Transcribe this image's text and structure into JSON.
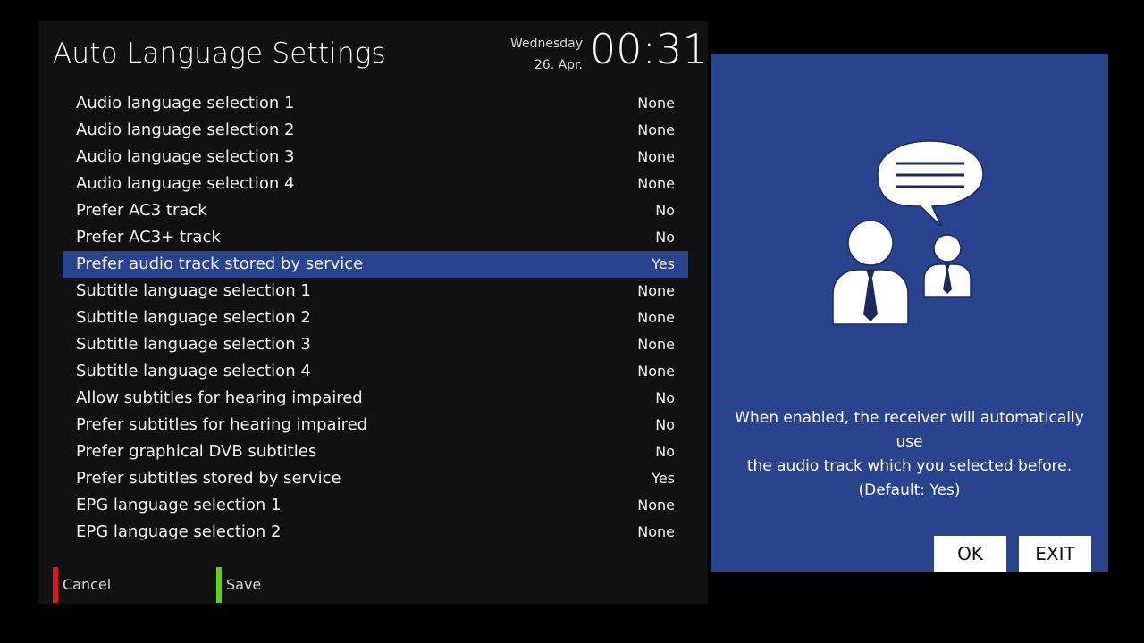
{
  "header": {
    "title": "Auto Language Settings",
    "weekday": "Wednesday",
    "date": "26. Apr.",
    "time": "00:31"
  },
  "settings": [
    {
      "label": "Audio language selection 1",
      "value": "None"
    },
    {
      "label": "Audio language selection 2",
      "value": "None"
    },
    {
      "label": "Audio language selection 3",
      "value": "None"
    },
    {
      "label": "Audio language selection 4",
      "value": "None"
    },
    {
      "label": "Prefer AC3 track",
      "value": "No"
    },
    {
      "label": "Prefer AC3+ track",
      "value": "No"
    },
    {
      "label": "Prefer audio track stored by service",
      "value": "Yes",
      "selected": true
    },
    {
      "label": "Subtitle language selection 1",
      "value": "None"
    },
    {
      "label": "Subtitle language selection 2",
      "value": "None"
    },
    {
      "label": "Subtitle language selection 3",
      "value": "None"
    },
    {
      "label": "Subtitle language selection 4",
      "value": "None"
    },
    {
      "label": "Allow subtitles for hearing impaired",
      "value": "No"
    },
    {
      "label": "Prefer subtitles for hearing impaired",
      "value": "No"
    },
    {
      "label": "Prefer graphical DVB subtitles",
      "value": "No"
    },
    {
      "label": "Prefer subtitles stored by service",
      "value": "Yes"
    },
    {
      "label": "EPG language selection 1",
      "value": "None"
    },
    {
      "label": "EPG language selection 2",
      "value": "None"
    }
  ],
  "keys": {
    "cancel": "Cancel",
    "save": "Save"
  },
  "help": {
    "line1": "When enabled, the receiver will automatically use",
    "line2": "the audio track which you selected before.",
    "line3": "(Default: Yes)",
    "ok_label": "OK",
    "exit_label": "EXIT",
    "illustration_icon": "people-conversation-icon"
  },
  "colors": {
    "selection": "#2a438f",
    "help_panel": "#2a438f",
    "red_key": "#d21a1a",
    "green_key": "#5fd11c"
  }
}
